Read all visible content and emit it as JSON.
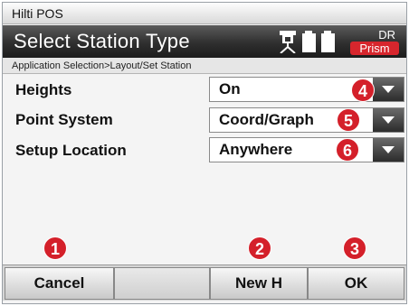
{
  "app": {
    "title": "Hilti POS"
  },
  "header": {
    "title": "Select Station Type",
    "station_icon": "total-station-icon",
    "battery_icon": "battery-icon",
    "mode_top": "DR",
    "mode_bottom": "Prism"
  },
  "breadcrumb": "Application Selection>Layout/Set Station",
  "fields": [
    {
      "label": "Heights",
      "value": "On",
      "marker": "4"
    },
    {
      "label": "Point System",
      "value": "Coord/Graph",
      "marker": "5"
    },
    {
      "label": "Setup Location",
      "value": "Anywhere",
      "marker": "6"
    }
  ],
  "softkeys": [
    {
      "label": "Cancel",
      "marker": "1"
    },
    {
      "label": ""
    },
    {
      "label": "New H",
      "marker": "2"
    },
    {
      "label": "OK",
      "marker": "3"
    }
  ],
  "colors": {
    "marker": "#d4202a",
    "prism_badge": "#d7262d",
    "header_bg": "#2f2f2f"
  }
}
